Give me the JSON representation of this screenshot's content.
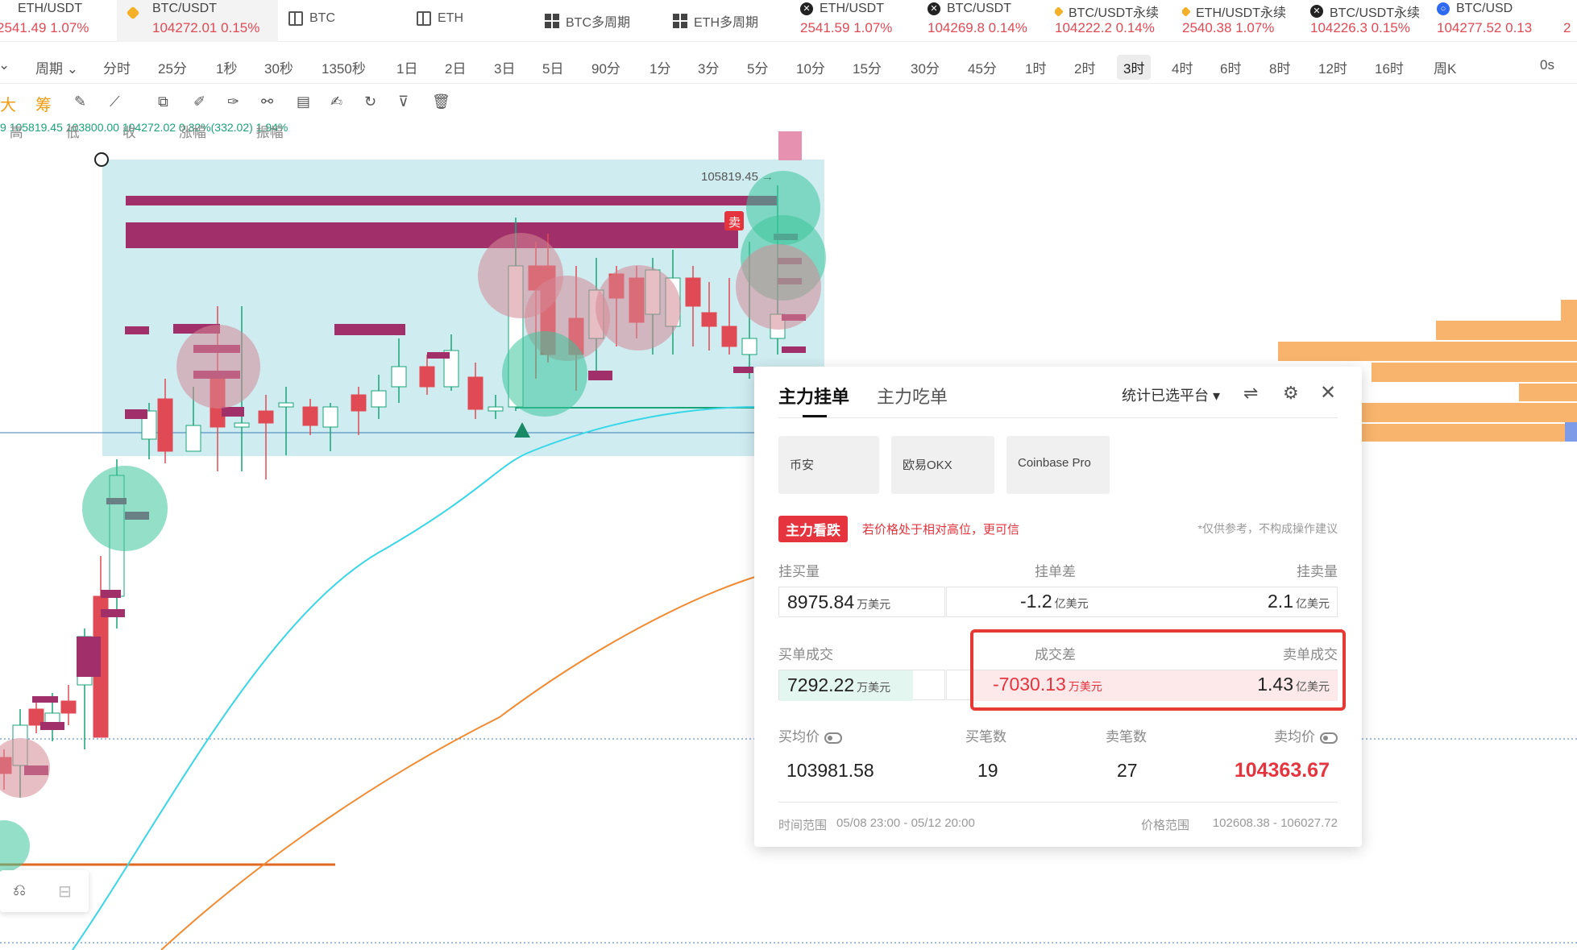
{
  "tickers": [
    {
      "pair": "ETH/USDT",
      "price": "2541.49",
      "change": "1.07%",
      "icon": "binance-icon"
    },
    {
      "pair": "BTC/USDT",
      "price": "104272.01",
      "change": "0.15%",
      "icon": "binance-icon",
      "active": true
    },
    {
      "pair": "BTC",
      "icon": "layout-icon"
    },
    {
      "pair": "ETH",
      "icon": "layout-icon"
    },
    {
      "pair": "BTC多周期",
      "icon": "grid-icon"
    },
    {
      "pair": "ETH多周期",
      "icon": "grid-icon"
    },
    {
      "pair": "ETH/USDT",
      "price": "2541.59",
      "change": "1.07%",
      "icon": "okx-icon"
    },
    {
      "pair": "BTC/USDT",
      "price": "104269.8",
      "change": "0.14%",
      "icon": "okx-icon"
    },
    {
      "pair": "BTC/USDT永续",
      "price": "104222.2",
      "change": "0.14%",
      "icon": "binance-icon"
    },
    {
      "pair": "ETH/USDT永续",
      "price": "2540.38",
      "change": "1.07%",
      "icon": "binance-icon"
    },
    {
      "pair": "BTC/USDT永续",
      "price": "104226.3",
      "change": "0.15%",
      "icon": "okx-icon"
    },
    {
      "pair": "BTC/USD",
      "price": "104277.52",
      "change": "0.13",
      "icon": "coinbase-icon"
    },
    {
      "price": "2"
    }
  ],
  "periods": {
    "menu": "周期",
    "items": [
      "分时",
      "25分",
      "1秒",
      "30秒",
      "1350秒",
      "1日",
      "2日",
      "3日",
      "5日",
      "90分",
      "1分",
      "3分",
      "5分",
      "10分",
      "15分",
      "30分",
      "45分",
      "1时",
      "2时",
      "3时",
      "4时",
      "6时",
      "8时",
      "12时",
      "16时",
      "周K"
    ],
    "selected": "3时",
    "right": "0s"
  },
  "tools": {
    "da": "大",
    "chou": "筹"
  },
  "ohlc": {
    "prefix": "9",
    "high_label": "高",
    "high": "105819.45",
    "low_label": "低",
    "low": "103800.00",
    "close_label": "收",
    "close": "104272.02",
    "change_label": "涨幅",
    "change": "0.32%(332.02)",
    "amp_label": "振幅",
    "amp": "1.94%"
  },
  "chart": {
    "high_marker": "105819.45 →",
    "sell_tag": "卖"
  },
  "panel": {
    "tab_active": "主力挂单",
    "tab_other": "主力吃单",
    "platform_select": "统计已选平台",
    "exchanges": [
      "币安",
      "欧易OKX",
      "Coinbase Pro"
    ],
    "badge": "主力看跌",
    "warning": "若价格处于相对高位，更可信",
    "note": "*仅供参考，不构成操作建议",
    "buy_orders_label": "挂买量",
    "order_diff_label": "挂单差",
    "sell_orders_label": "挂卖量",
    "buy_orders_value": "8975.84",
    "buy_orders_unit": "万美元",
    "order_diff_value": "-1.2",
    "order_diff_unit": "亿美元",
    "sell_orders_value": "2.1",
    "sell_orders_unit": "亿美元",
    "buy_fill_label": "买单成交",
    "fill_diff_label": "成交差",
    "sell_fill_label": "卖单成交",
    "buy_fill_value": "7292.22",
    "buy_fill_unit": "万美元",
    "fill_diff_value": "-7030.13",
    "fill_diff_unit": "万美元",
    "sell_fill_value": "1.43",
    "sell_fill_unit": "亿美元",
    "avg_buy_label": "买均价",
    "buy_count_label": "买笔数",
    "sell_count_label": "卖笔数",
    "avg_sell_label": "卖均价",
    "avg_buy_value": "103981.58",
    "buy_count_value": "19",
    "sell_count_value": "27",
    "avg_sell_value": "104363.67",
    "time_range_label": "时间范围",
    "time_range_value": "05/08 23:00 - 05/12 20:00",
    "price_range_label": "价格范围",
    "price_range_value": "102608.38 - 106027.72"
  },
  "colors": {
    "up": "#1aa377",
    "down": "#e04a55",
    "accent_red": "#e5343e",
    "zone": "#bfe7ec",
    "order_bar": "#a1306a",
    "ma_fast": "#39d6e8",
    "ma_slow": "#f08b32"
  }
}
